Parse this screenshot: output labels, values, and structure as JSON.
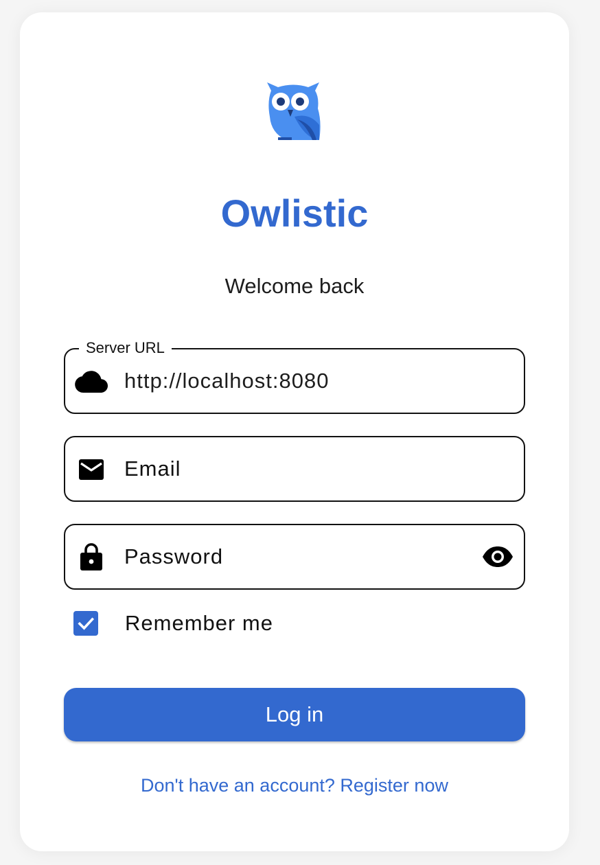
{
  "app": {
    "title": "Owlistic",
    "subtitle": "Welcome back",
    "logo_icon": "owl-icon",
    "accent_color": "#3369cf"
  },
  "form": {
    "server_url": {
      "label": "Server URL",
      "value": "http://localhost:8080",
      "icon": "cloud-icon"
    },
    "email": {
      "placeholder": "Email",
      "value": "",
      "icon": "mail-icon"
    },
    "password": {
      "placeholder": "Password",
      "value": "",
      "icon": "lock-icon",
      "toggle_icon": "eye-icon"
    },
    "remember": {
      "label": "Remember me",
      "checked": true
    },
    "login_label": "Log in",
    "register_link": "Don't have an account? Register now"
  }
}
